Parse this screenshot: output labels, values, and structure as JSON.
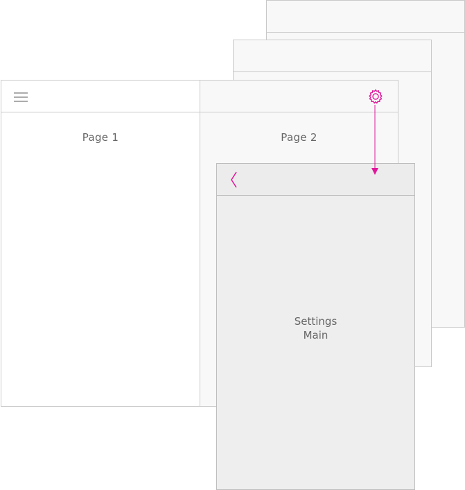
{
  "accent_color": "#e0169b",
  "screens": {
    "page1": {
      "label": "Page 1"
    },
    "page2": {
      "label": "Page 2"
    },
    "settings": {
      "label_line1": "Settings",
      "label_line2": "Main"
    }
  },
  "icons": {
    "menu": "hamburger-icon",
    "settings": "gear-icon",
    "back": "back-chevron-icon"
  }
}
